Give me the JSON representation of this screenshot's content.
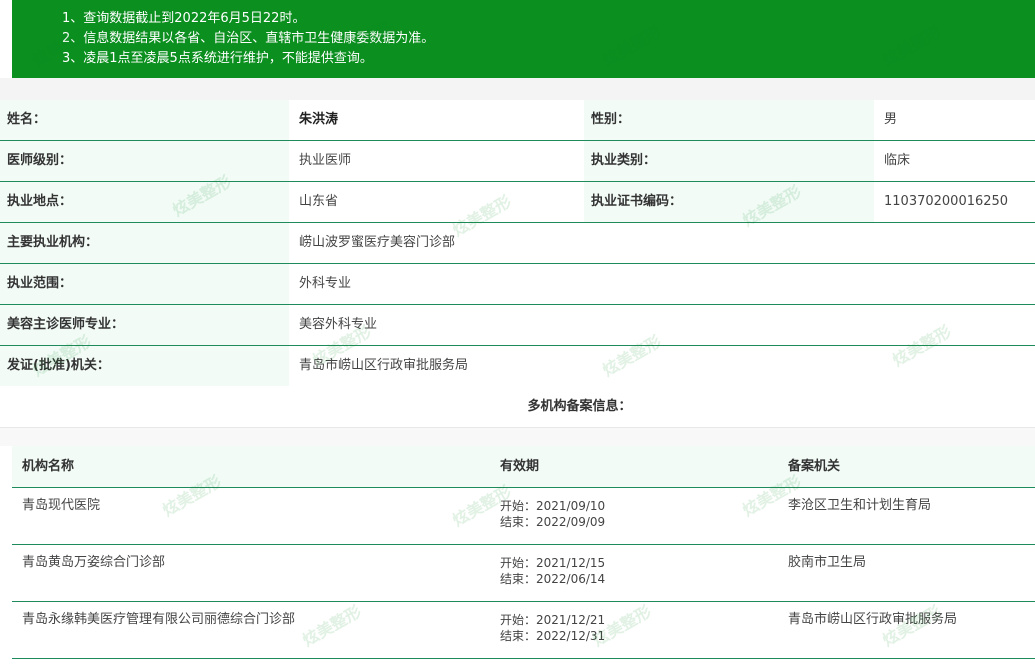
{
  "notice": {
    "lines": [
      "1、查询数据截止到2022年6月5日22时。",
      "2、信息数据结果以各省、自治区、直辖市卫生健康委数据为准。",
      "3、凌晨1点至凌晨5点系统进行维护，不能提供查询。"
    ]
  },
  "doctor": {
    "name_label": "姓名：",
    "name": "朱洪涛",
    "gender_label": "性别：",
    "gender": "男",
    "level_label": "医师级别：",
    "level": "执业医师",
    "category_label": "执业类别：",
    "category": "临床",
    "location_label": "执业地点：",
    "location": "山东省",
    "cert_label": "执业证书编码：",
    "cert": "110370200016250",
    "institution_label": "主要执业机构：",
    "institution": "崂山波罗蜜医疗美容门诊部",
    "scope_label": "执业范围：",
    "scope": "外科专业",
    "specialty_label": "美容主诊医师专业：",
    "specialty": "美容外科专业",
    "issuer_label": "发证(批准)机关：",
    "issuer": "青岛市崂山区行政审批服务局"
  },
  "multi": {
    "title": "多机构备案信息：",
    "headers": [
      "机构名称",
      "有效期",
      "备案机关"
    ],
    "rows": [
      {
        "name": "青岛现代医院",
        "start": "开始：2021/09/10",
        "end": "结束：2022/09/09",
        "authority": "李沧区卫生和计划生育局"
      },
      {
        "name": "青岛黄岛万姿综合门诊部",
        "start": "开始：2021/12/15",
        "end": "结束：2022/06/14",
        "authority": "胶南市卫生局"
      },
      {
        "name": "青岛永缘韩美医疗管理有限公司丽德综合门诊部",
        "start": "开始：2021/12/21",
        "end": "结束：2022/12/31",
        "authority": "青岛市崂山区行政审批服务局"
      }
    ]
  },
  "watermark": "炫美整形",
  "colors": {
    "header_green": "#0b8f1f",
    "border_green": "#1f8a5b",
    "label_bg": "#f2fbf6"
  }
}
